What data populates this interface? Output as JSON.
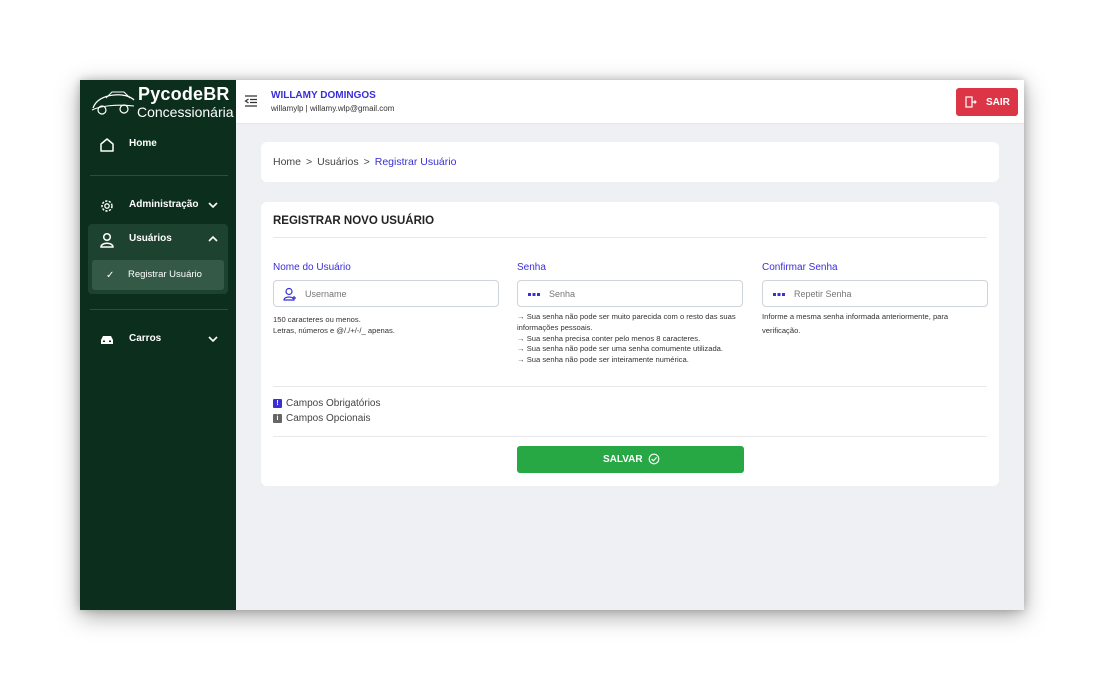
{
  "brand": {
    "name": "PycodeBR",
    "subtitle": "Concessionária"
  },
  "sidebar": {
    "home": "Home",
    "administracao": "Administração",
    "usuarios": "Usuários",
    "registrar_usuario": "Registrar Usuário",
    "carros": "Carros"
  },
  "header": {
    "user_name": "WILLAMY DOMINGOS",
    "user_info": "willamylp | willamy.wlp@gmail.com",
    "logout_label": "SAIR"
  },
  "breadcrumb": {
    "home": "Home",
    "sep1": ">",
    "usuarios": "Usuários",
    "sep2": ">",
    "current": "Registrar Usuário"
  },
  "form": {
    "title": "REGISTRAR NOVO USUÁRIO",
    "username": {
      "label": "Nome do Usuário",
      "placeholder": "Username",
      "help": [
        "150 caracteres ou menos.",
        "Letras, números e @/./+/-/_ apenas."
      ]
    },
    "password": {
      "label": "Senha",
      "placeholder": "Senha",
      "help": [
        "→ Sua senha não pode ser muito parecida com o resto das suas",
        "informações pessoais.",
        "→ Sua senha precisa conter pelo menos 8 caracteres.",
        "→ Sua senha não pode ser uma senha comumente utilizada.",
        "→ Sua senha não pode ser inteiramente numérica."
      ]
    },
    "confirm": {
      "label": "Confirmar Senha",
      "placeholder": "Repetir Senha",
      "help": [
        "Informe a mesma senha informada anteriormente, para",
        "verificação."
      ]
    },
    "legend": {
      "required": "Campos Obrigatórios",
      "optional": "Campos Opcionais",
      "required_mark": "!",
      "optional_mark": "i"
    },
    "save_label": "SALVAR"
  },
  "colors": {
    "sidebar": "#0c2e1c",
    "accent": "#3a2fd6",
    "danger": "#dc3545",
    "success": "#28a745"
  }
}
